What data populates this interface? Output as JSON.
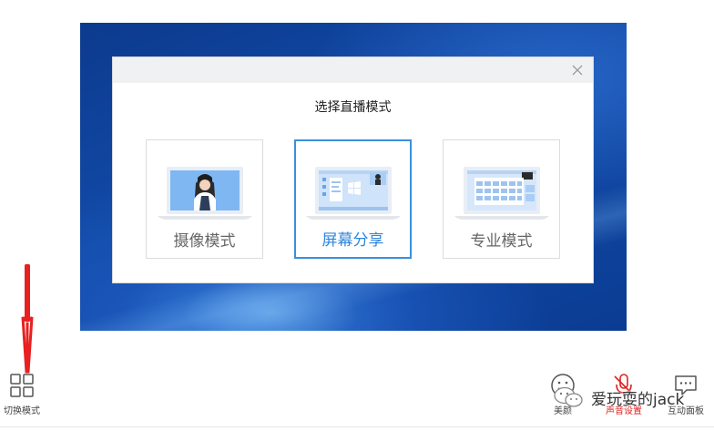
{
  "dialog": {
    "title": "选择直播模式",
    "modes": [
      {
        "label": "摄像模式",
        "selected": false
      },
      {
        "label": "屏幕分享",
        "selected": true
      },
      {
        "label": "专业模式",
        "selected": false
      }
    ]
  },
  "toolbar": {
    "switch_mode": "切换模式",
    "beauty": "美颜",
    "sound_settings": "声音设置",
    "interactive_board": "互动面板"
  },
  "watermark": "爱玩耍的jack",
  "colors": {
    "accent": "#3a8fe0",
    "alert": "#e02020",
    "wallpaper": "#124ba8"
  }
}
